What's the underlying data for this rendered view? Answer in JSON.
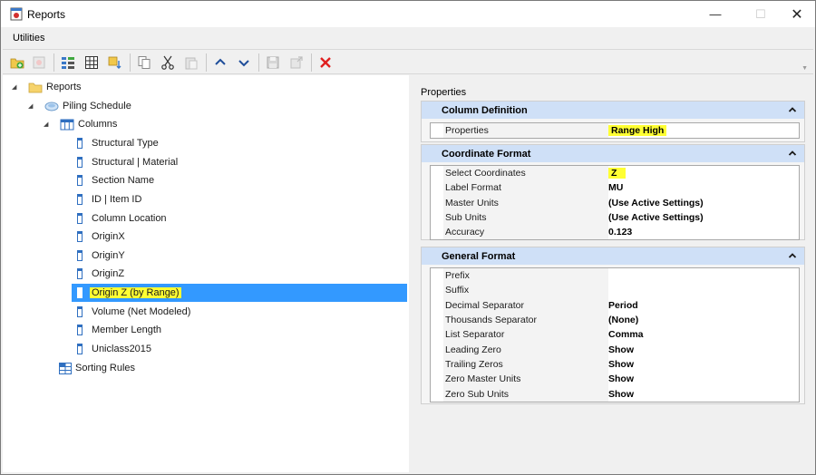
{
  "window": {
    "title": "Reports",
    "controls": {
      "minimize": "—",
      "maximize": "☐",
      "close": "✕"
    }
  },
  "menu": {
    "items": [
      "Utilities"
    ]
  },
  "toolbar": {
    "buttons": [
      "new-report-icon",
      "disabled-icon",
      "column-icon",
      "table-icon",
      "sort-icon",
      "copy-icon",
      "cut-icon",
      "paste-icon",
      "move-up-icon",
      "move-down-icon",
      "save-icon",
      "export-icon",
      "delete-icon"
    ]
  },
  "tree": {
    "root": "Reports",
    "report": "Piling Schedule",
    "columns_folder": "Columns",
    "columns": [
      "Structural Type",
      "Structural | Material",
      "Section Name",
      "ID | Item ID",
      "Column Location",
      "OriginX",
      "OriginY",
      "OriginZ",
      "Origin Z (by Range)",
      "Volume (Net Modeled)",
      "Member Length",
      "Uniclass2015"
    ],
    "sorting": "Sorting Rules"
  },
  "properties": {
    "title": "Properties",
    "sections": [
      {
        "header": "Column Definition",
        "rows": [
          {
            "name": "Properties",
            "value": "Range High",
            "highlight": true
          }
        ]
      },
      {
        "header": "Coordinate Format",
        "rows": [
          {
            "name": "Select Coordinates",
            "value": "Z",
            "highlight": true
          },
          {
            "name": "Label Format",
            "value": "MU"
          },
          {
            "name": "Master Units",
            "value": "(Use Active Settings)"
          },
          {
            "name": "Sub Units",
            "value": "(Use Active Settings)"
          },
          {
            "name": "Accuracy",
            "value": "0.123"
          }
        ]
      },
      {
        "header": "General Format",
        "rows": [
          {
            "name": "Prefix",
            "value": ""
          },
          {
            "name": "Suffix",
            "value": ""
          },
          {
            "name": "Decimal Separator",
            "value": "Period"
          },
          {
            "name": "Thousands Separator",
            "value": "(None)"
          },
          {
            "name": "List Separator",
            "value": "Comma"
          },
          {
            "name": "Leading Zero",
            "value": "Show"
          },
          {
            "name": "Trailing Zeros",
            "value": "Show"
          },
          {
            "name": "Zero Master Units",
            "value": "Show"
          },
          {
            "name": "Zero Sub Units",
            "value": "Show"
          }
        ]
      }
    ]
  },
  "colors": {
    "selection": "#3399ff",
    "highlight": "#ffff33",
    "section_header": "#cfe0f7",
    "delete": "#e02020"
  }
}
